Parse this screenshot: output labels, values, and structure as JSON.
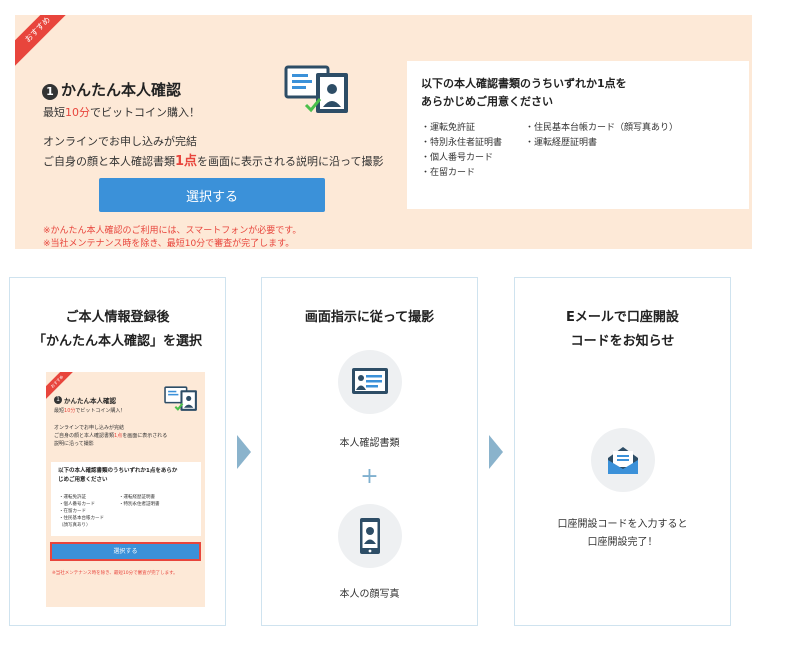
{
  "top": {
    "ribbon": "おすすめ",
    "number": "1",
    "title": "かんたん本人確認",
    "subtitle_prefix": "最短",
    "subtitle_highlight": "10分",
    "subtitle_suffix": "でビットコイン購入！",
    "desc_line1": "オンラインでお申し込みが完結",
    "desc_line2_prefix": "ご自身の顔と本人確認書類",
    "desc_line2_highlight": "1点",
    "desc_line2_suffix": "を画面に表示される説明に沿って撮影",
    "button_label": "選択する",
    "notes": [
      "※かんたん本人確認のご利用には、スマートフォンが必要です。",
      "※当社メンテナンス時を除き、最短10分で審査が完了します。"
    ],
    "doc_box": {
      "heading_line1": "以下の本人確認書類のうちいずれか1点を",
      "heading_line2": "あらかじめご用意ください",
      "list_left": [
        "・運転免許証",
        "・特別永住者証明書",
        "・個人番号カード",
        "・在留カード"
      ],
      "list_right": [
        "・住民基本台帳カード（顔写真あり）",
        "・運転経歴証明書"
      ]
    }
  },
  "steps": [
    {
      "title_line1": "ご本人情報登録後",
      "title_line2": "「かんたん本人確認」を選択",
      "thumb": {
        "ribbon": "おすすめ",
        "number": "1",
        "title": "かんたん本人確認",
        "sub_prefix": "最短",
        "sub_highlight": "10分",
        "sub_suffix": "でビットコイン購入！",
        "desc1": "オンラインでお申し込みが完結",
        "desc2_prefix": "ご自身の顔と本人確認書類",
        "desc2_highlight": "1点",
        "desc2_suffix": "を画面に表示される",
        "desc3": "説明に沿って撮影",
        "box_heading_line1": "以下の本人確認書類のうちいずれか1点をあらか",
        "box_heading_line2": "じめご用意ください",
        "list_left": [
          "・運転免許証",
          "・個人番号カード",
          "・在留カード",
          "・住民基本台帳カード",
          "（顔写真あり）"
        ],
        "list_right": [
          "・運転経歴証明書",
          "・特別永住者証明書"
        ],
        "button_label": "選択する",
        "note": "※当社メンテナンス時を除き、最短10分で審査が完了します。"
      }
    },
    {
      "title_line1": "画面指示に従って撮影",
      "label_top": "本人確認書類",
      "plus": "+",
      "label_bottom": "本人の顔写真"
    },
    {
      "title_line1": "Eメールで口座開設",
      "title_line2": "コードをお知らせ",
      "label_line1": "口座開設コードを入力すると",
      "label_line2": "口座開設完了！"
    }
  ],
  "colors": {
    "panel_bg": "#fde9d7",
    "accent_red": "#e8453c",
    "button_blue": "#3b91d9",
    "arrow": "#8ab3cc",
    "card_border": "#cfe3ef"
  },
  "icons": [
    "id-card-check-icon",
    "id-card-icon",
    "smartphone-selfie-icon",
    "mail-open-icon",
    "step-arrow-icon"
  ]
}
